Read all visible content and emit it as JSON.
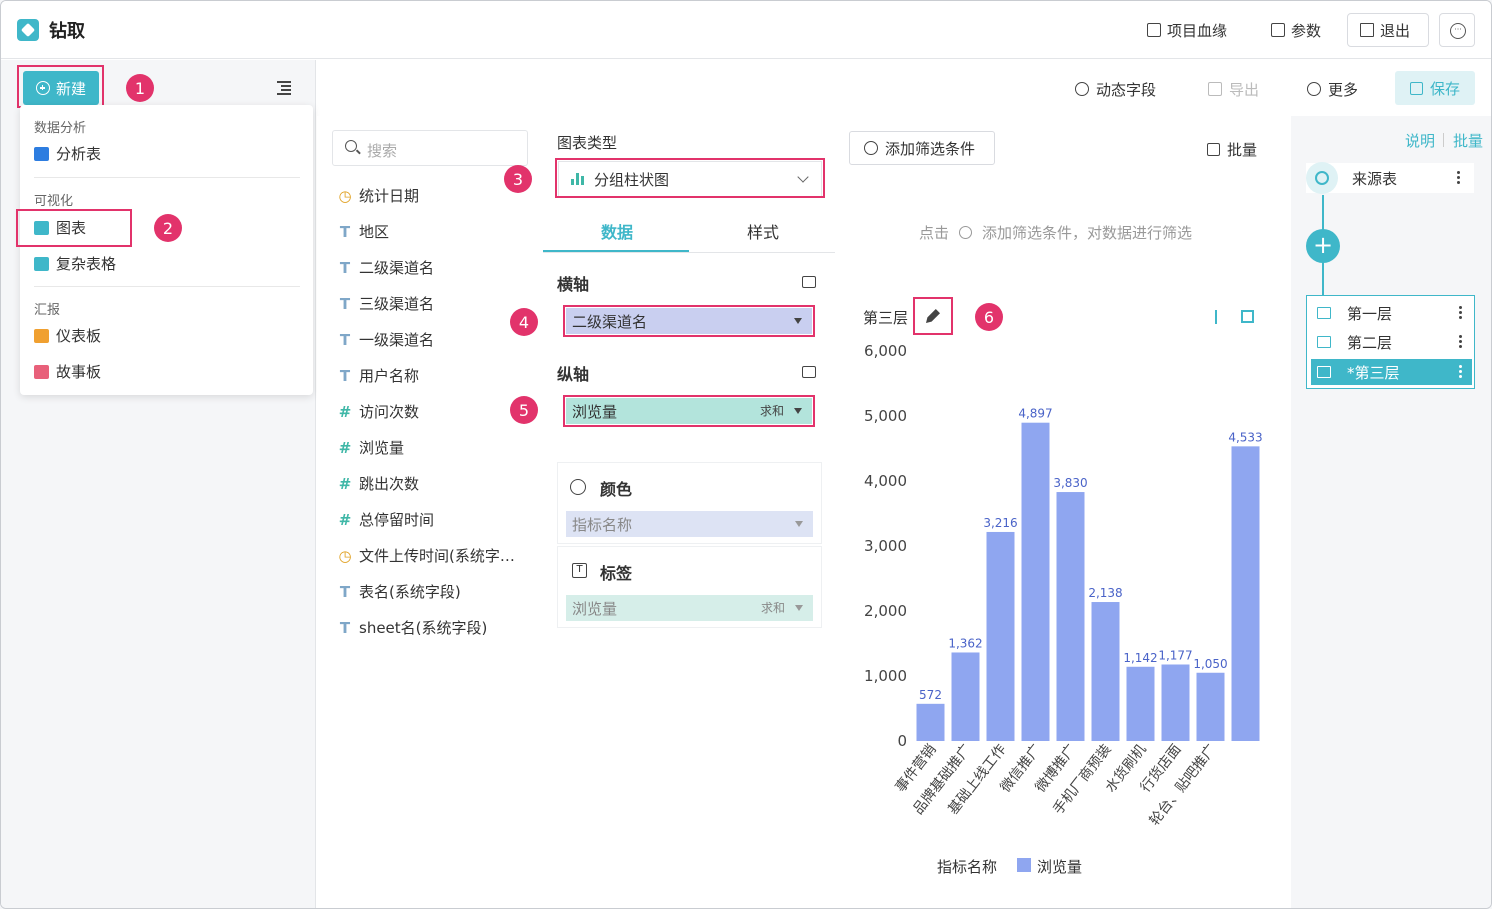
{
  "header": {
    "title": "钻取",
    "lineage": "项目血缘",
    "params": "参数",
    "exit": "退出"
  },
  "sidebar": {
    "new_label": "新建",
    "menu": {
      "group_analysis": "数据分析",
      "item_analysis_table": "分析表",
      "group_visual": "可视化",
      "item_chart": "图表",
      "item_complex_table": "复杂表格",
      "group_report": "汇报",
      "item_dashboard": "仪表板",
      "item_storyboard": "故事板"
    }
  },
  "badges": [
    "1",
    "2",
    "3",
    "4",
    "5",
    "6"
  ],
  "toolbar": {
    "dynamic_field": "动态字段",
    "export": "导出",
    "more": "更多",
    "save": "保存"
  },
  "fields": {
    "search_placeholder": "搜索",
    "items": [
      {
        "type": "date",
        "name": "统计日期"
      },
      {
        "type": "text",
        "name": "地区"
      },
      {
        "type": "text",
        "name": "二级渠道名"
      },
      {
        "type": "text",
        "name": "三级渠道名"
      },
      {
        "type": "text",
        "name": "一级渠道名"
      },
      {
        "type": "text",
        "name": "用户名称"
      },
      {
        "type": "num",
        "name": "访问次数"
      },
      {
        "type": "num",
        "name": "浏览量"
      },
      {
        "type": "num",
        "name": "跳出次数"
      },
      {
        "type": "num",
        "name": "总停留时间"
      },
      {
        "type": "date",
        "name": "文件上传时间(系统字…"
      },
      {
        "type": "text",
        "name": "表名(系统字段)"
      },
      {
        "type": "text",
        "name": "sheet名(系统字段)"
      }
    ]
  },
  "config": {
    "chart_type_label": "图表类型",
    "chart_type_value": "分组柱状图",
    "tab_data": "数据",
    "tab_style": "样式",
    "x_axis_label": "横轴",
    "x_axis_field": "二级渠道名",
    "y_axis_label": "纵轴",
    "y_axis_field": "浏览量",
    "y_axis_agg": "求和",
    "color_label": "颜色",
    "color_field": "指标名称",
    "tag_label": "标签",
    "tag_field": "浏览量",
    "tag_agg": "求和"
  },
  "filter": {
    "add_label": "添加筛选条件",
    "batch_label": "批量",
    "hint_prefix": "点击",
    "hint_suffix": "添加筛选条件，对数据进行筛选"
  },
  "chart_panel": {
    "layer_title": "第三层"
  },
  "chart_data": {
    "type": "bar",
    "categories": [
      "事件营销",
      "品牌基础推广",
      "基础上线工作",
      "微信推广",
      "微博推广",
      "手机厂商预装",
      "水货刷机",
      "行货店面",
      "轮台、贴吧推广"
    ],
    "series": [
      {
        "name": "浏览量",
        "values": [
          572,
          1362,
          3216,
          4897,
          3830,
          2138,
          1142,
          1177,
          1050,
          4533
        ]
      }
    ],
    "value_labels": [
      "572",
      "1,362",
      "3,216",
      "4,897",
      "3,830",
      "2,138",
      "1,142",
      "1,177",
      "1,050",
      "4,533"
    ],
    "y_ticks": [
      "0",
      "1,000",
      "2,000",
      "3,000",
      "4,000",
      "5,000",
      "6,000"
    ],
    "ylim": [
      0,
      6000
    ],
    "legend_title": "指标名称",
    "legend_item": "浏览量",
    "bar_color": "#8fa6f0"
  },
  "right_panel": {
    "explain": "说明",
    "batch": "批量",
    "source_table": "来源表",
    "layers": [
      "第一层",
      "第二层",
      "*第三层"
    ]
  },
  "colors": {
    "accent": "#3fb7c9",
    "highlight": "#e2336b",
    "axis_field_x": "#c9cff0",
    "axis_field_y": "#b3e4dc"
  }
}
